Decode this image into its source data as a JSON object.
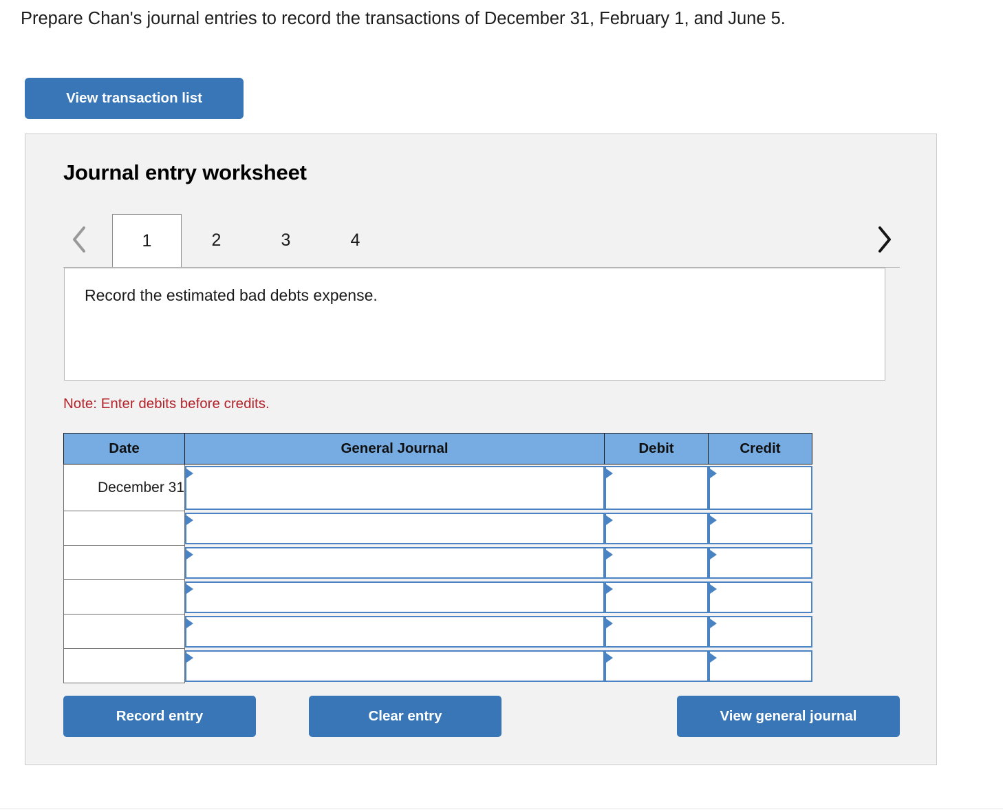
{
  "prompt": "Prepare Chan's journal entries to record the transactions of December 31, February 1, and June 5.",
  "top_actions": {
    "view_transaction_list": "View transaction list"
  },
  "worksheet": {
    "title": "Journal entry worksheet",
    "nav": {
      "prev_icon": "chevron-left-icon",
      "next_icon": "chevron-right-icon"
    },
    "tabs": [
      {
        "label": "1",
        "active": true
      },
      {
        "label": "2",
        "active": false
      },
      {
        "label": "3",
        "active": false
      },
      {
        "label": "4",
        "active": false
      }
    ],
    "description": "Record the estimated bad debts expense.",
    "note": "Note: Enter debits before credits.",
    "table": {
      "headers": [
        "Date",
        "General Journal",
        "Debit",
        "Credit"
      ],
      "rows": [
        {
          "date": "December 31",
          "journal": "",
          "debit": "",
          "credit": ""
        },
        {
          "date": "",
          "journal": "",
          "debit": "",
          "credit": ""
        },
        {
          "date": "",
          "journal": "",
          "debit": "",
          "credit": ""
        },
        {
          "date": "",
          "journal": "",
          "debit": "",
          "credit": ""
        },
        {
          "date": "",
          "journal": "",
          "debit": "",
          "credit": ""
        },
        {
          "date": "",
          "journal": "",
          "debit": "",
          "credit": ""
        }
      ]
    },
    "buttons": {
      "record_entry": "Record entry",
      "clear_entry": "Clear entry",
      "view_general_journal": "View general journal"
    }
  },
  "colors": {
    "button_blue": "#3876b8",
    "header_blue": "#77ace3",
    "cell_border_blue": "#4a83c4",
    "note_red": "#b3232b",
    "panel_bg": "#f2f2f2"
  }
}
